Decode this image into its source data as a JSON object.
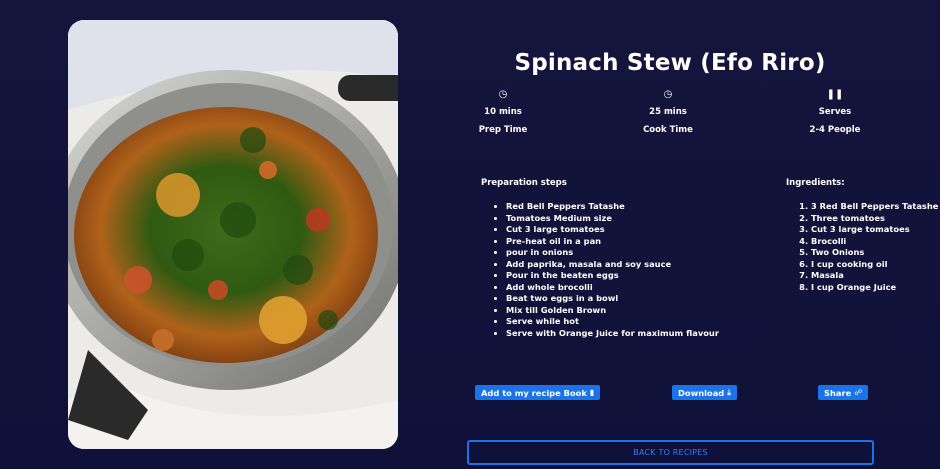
{
  "recipe": {
    "title": "Spinach Stew (Efo Riro)",
    "image_alt": "Spinach Stew (Efo Riro) in a pot"
  },
  "meta": [
    {
      "icon": "clock-icon",
      "value": "10 mins",
      "label": "Prep Time"
    },
    {
      "icon": "clock-icon",
      "value": "25 mins",
      "label": "Cook Time"
    },
    {
      "icon": "utensils-icon",
      "value": "Serves",
      "label": "2-4 People"
    }
  ],
  "steps": {
    "heading": "Preparation steps",
    "items": [
      "Red Bell Peppers Tatashe",
      "Tomatoes Medium size",
      "Cut 3 large tomatoes",
      "Pre-heat oil in a pan",
      "pour in onions",
      "Add paprika, masala and soy sauce",
      "Pour in the beaten eggs",
      "Add whole brocolli",
      "Beat two eggs in a bowl",
      "Mix till Golden Brown",
      "Serve while hot",
      "Serve with Orange Juice for maximum flavour"
    ]
  },
  "ingredients": {
    "heading": "Ingredients:",
    "items": [
      "3 Red Bell Peppers Tatashe",
      "Three tomatoes",
      "Cut 3 large tomatoes",
      "Brocolli",
      "Two Onions",
      "I cup cooking oil",
      "Masala",
      "I cup Orange Juice"
    ]
  },
  "actions": {
    "add_label": "Add to my recipe Book",
    "download_label": "Download",
    "share_label": "Share",
    "back_label": "BACK TO RECIPES"
  },
  "colors": {
    "background": "#12123a",
    "accent": "#1a73e8"
  }
}
